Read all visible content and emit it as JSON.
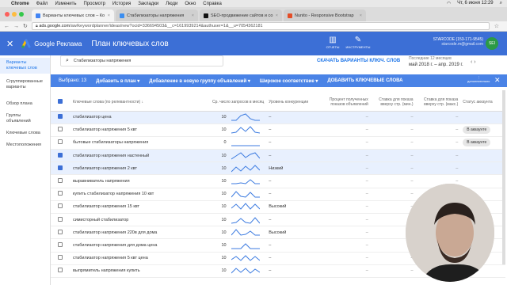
{
  "menubar": {
    "app": "Chrome",
    "items": [
      "Файл",
      "Изменить",
      "Просмотр",
      "История",
      "Закладки",
      "Люди",
      "Окно",
      "Справка"
    ],
    "clock": "Чт, 6 июня 12:29"
  },
  "tabs": [
    {
      "label": "Варианты ключевых слов – Ко",
      "fav": "#4285f4"
    },
    {
      "label": "Стабилизаторы напряжения",
      "fav": "#3b8ef0"
    },
    {
      "label": "SEO-продвижение сайтов и со",
      "fav": "#111111"
    },
    {
      "label": "Nunito - Responsive Bootstrap",
      "fav": "#e44d26"
    }
  ],
  "url": {
    "host": "ads.google.com",
    "path": "/aw/keywordplanner/ideas/new?ocid=336694503&__c=1619939214&authuser=1&__u=7054362181"
  },
  "ads": {
    "brand": "Google Реклама",
    "title": "План ключевых слов",
    "tools": [
      {
        "icon": "☰",
        "label": "ОТЧЕТЫ"
      },
      {
        "icon": "⚙",
        "label": "ИНСТРУМЕНТЫ"
      }
    ],
    "account_name": "STARCODE (153-171-9545)",
    "account_email": "starcode.m@gmail.com",
    "avatar": "SEI"
  },
  "sidebar": [
    {
      "label": "Варианты ключевых слов",
      "active": true
    },
    {
      "label": "Сгруппированные варианты",
      "active": false
    },
    {
      "label": "Обзор плана",
      "active": false
    },
    {
      "label": "Группы объявлений",
      "active": false
    },
    {
      "label": "Ключевые слова",
      "active": false
    },
    {
      "label": "Местоположения",
      "active": false
    }
  ],
  "search": {
    "value": "Стабилизаторы напряжения"
  },
  "show_button": "СКАЧАТЬ ВАРИАНТЫ КЛЮЧ. СЛОВ",
  "period": {
    "label": "Последние 12 месяцев",
    "value": "май 2018 г. – апр. 2019 г."
  },
  "selection": {
    "count": "Выбрано: 13",
    "actions": [
      "Добавить в план",
      "Добавление в новую группу объявлений",
      "Широкое соответствие"
    ],
    "primary": "ДОБАВИТЬ КЛЮЧЕВЫЕ СЛОВА",
    "more": "дополнительно"
  },
  "columns": [
    "Ключевые слова (по релевантности)",
    "Ср. число запросов в месяц",
    "Уровень конкуренции",
    "Процент полученных показов объявлений",
    "Ставка для показа вверху стр. (мин.)",
    "Ставка для показа вверху стр. (макс.)",
    "Статус аккаунта"
  ],
  "rows": [
    {
      "kw": "стабилизатор цена",
      "vol": "10",
      "comp": "–",
      "share": "–",
      "low": "–",
      "high": "–",
      "status": "",
      "checked": true
    },
    {
      "kw": "стабилизатор напряжения 5 квт",
      "vol": "10",
      "comp": "–",
      "share": "–",
      "low": "–",
      "high": "–",
      "status": "В аккаунте",
      "checked": false
    },
    {
      "kw": "бытовые стабилизаторы напряжения",
      "vol": "0",
      "comp": "–",
      "share": "–",
      "low": "–",
      "high": "–",
      "status": "В аккаунте",
      "checked": false
    },
    {
      "kw": "стабилизатор напряжения настенный",
      "vol": "10",
      "comp": "–",
      "share": "–",
      "low": "–",
      "high": "–",
      "status": "",
      "checked": true
    },
    {
      "kw": "стабилизатор напряжения 2 квт",
      "vol": "10",
      "comp": "Низкий",
      "share": "–",
      "low": "–",
      "high": "–",
      "status": "",
      "checked": true
    },
    {
      "kw": "выравниватель напряжения",
      "vol": "10",
      "comp": "–",
      "share": "–",
      "low": "–",
      "high": "–",
      "status": "",
      "checked": false
    },
    {
      "kw": "купить стабилизатор напряжения 10 квт",
      "vol": "10",
      "comp": "–",
      "share": "–",
      "low": "–",
      "high": "–",
      "status": "",
      "checked": false
    },
    {
      "kw": "стабилизатор напряжения 15 квт",
      "vol": "10",
      "comp": "Высокий",
      "share": "–",
      "low": "–",
      "high": "–",
      "status": "",
      "checked": false
    },
    {
      "kw": "симисторный стабилизатор",
      "vol": "10",
      "comp": "–",
      "share": "–",
      "low": "–",
      "high": "–",
      "status": "",
      "checked": false
    },
    {
      "kw": "стабилизатор напряжения 220в для дома",
      "vol": "10",
      "comp": "Высокий",
      "share": "–",
      "low": "–",
      "high": "–",
      "status": "",
      "checked": false
    },
    {
      "kw": "стабилизатор напряжения для дома цена",
      "vol": "10",
      "comp": "–",
      "share": "–",
      "low": "–",
      "high": "–",
      "status": "",
      "checked": false
    },
    {
      "kw": "стабилизатор напряжения 5 квт цена",
      "vol": "10",
      "comp": "–",
      "share": "–",
      "low": "–",
      "high": "–",
      "status": "",
      "checked": false
    },
    {
      "kw": "выпрямитель напряжения купить",
      "vol": "10",
      "comp": "–",
      "share": "–",
      "low": "–",
      "high": "–",
      "status": "",
      "checked": false
    }
  ]
}
